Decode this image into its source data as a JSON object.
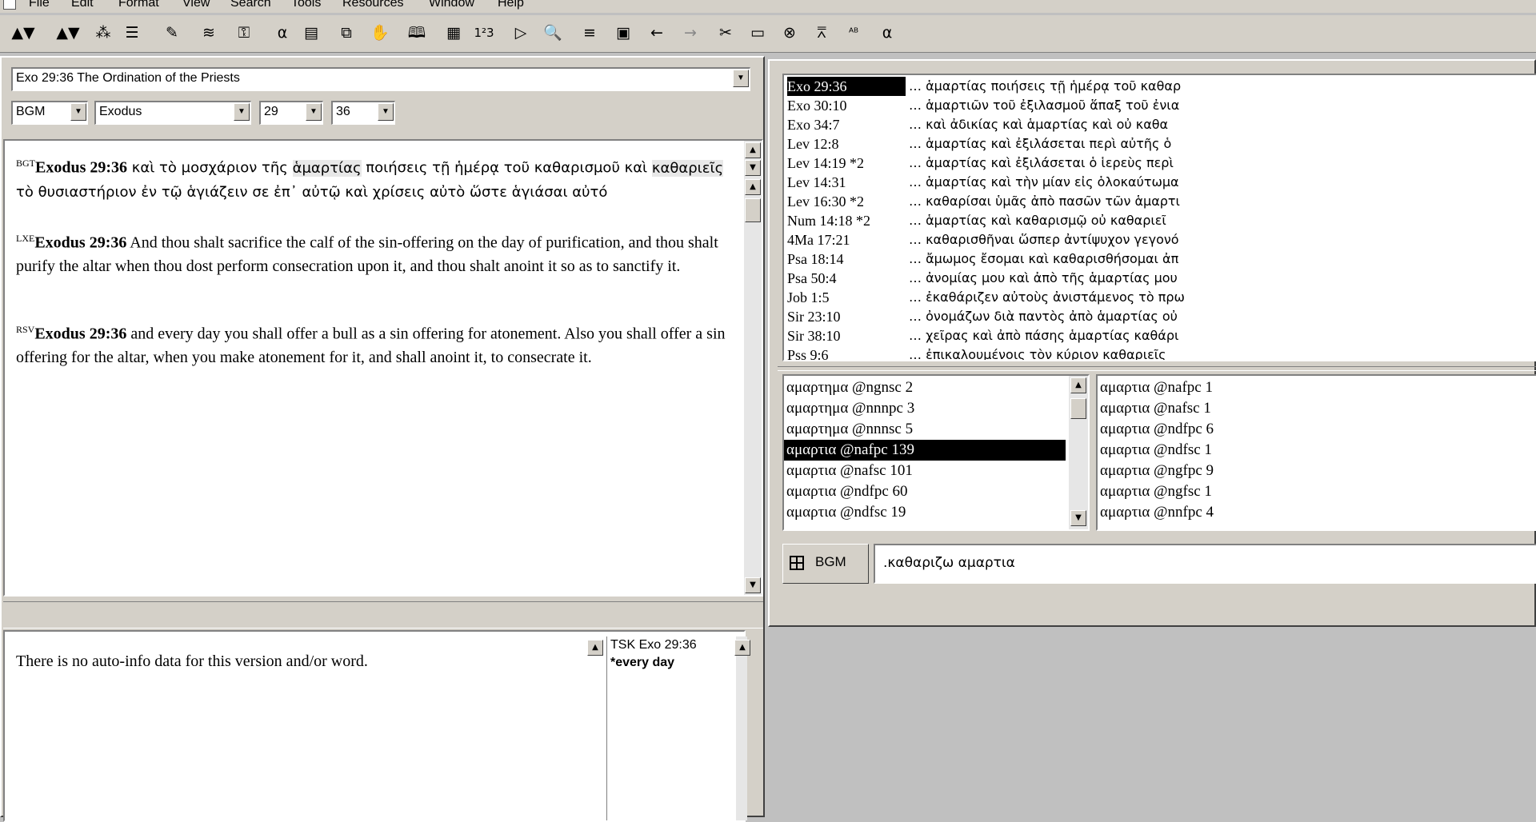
{
  "menu": [
    "File",
    "Edit",
    "Format",
    "View",
    "Search",
    "Tools",
    "Resources",
    "Window",
    "Help"
  ],
  "toolbar_icons": [
    "▲▼",
    "▲▼",
    "⁂",
    "☰",
    "✎",
    "≋",
    "⚿",
    "α",
    "▤",
    "⧉",
    "✋",
    "🕮",
    "▦",
    "1²3",
    "▷",
    "🔍",
    "≡",
    "▣",
    "←",
    "→",
    "✂",
    "▭",
    "⊗",
    "⩞",
    "ᴬᴮ",
    "α"
  ],
  "left": {
    "title": "Exo 29:36 The Ordination of the Priests",
    "version": "BGM",
    "book": "Exodus",
    "chapter": "29",
    "verse": "36",
    "verses": [
      {
        "tag": "BGT",
        "ref": "Exodus 29:36",
        "pre": " καὶ τὸ μοσχάριον τῆς ",
        "hl1": "ἁμαρτίας",
        "mid": " ποιήσεις τῇ ἡμέρᾳ τοῦ καθαρισμοῦ καὶ ",
        "hl2": "καθαριεῖς",
        "post": " τὸ θυσιαστήριον ἐν τῷ ἁγιάζειν σε ἐπ᾽ αὐτῷ καὶ χρίσεις αὐτὸ ὥστε ἁγιάσαι αὐτό"
      },
      {
        "tag": "LXE",
        "ref": "Exodus 29:36",
        "text": " And thou shalt sacrifice the calf of the sin-offering on the day of purification, and thou shalt purify the altar when thou dost perform consecration upon it, and thou shalt anoint it so as to sanctify it."
      },
      {
        "tag": "RSV",
        "ref": "Exodus 29:36",
        "text": " and every day you shall offer a bull as a sin offering for atonement. Also you shall offer a sin offering for the altar, when you make atonement for it, and shall anoint it, to consecrate it."
      }
    ],
    "autoinfo": "There is no auto-info data for this version and/or word.",
    "tsk_ref": "TSK Exo 29:36",
    "tsk_word": "*every day"
  },
  "right": {
    "results": [
      {
        "ref": "Exo 29:36",
        "text": "… ἁμαρτίας ποιήσεις τῇ ἡμέρᾳ τοῦ καθαρ",
        "selected": true
      },
      {
        "ref": "Exo 30:10",
        "text": "… ἁμαρτιῶν τοῦ ἐξιλασμοῦ ἅπαξ τοῦ ἐνια"
      },
      {
        "ref": "Exo 34:7",
        "text": "… καὶ ἀδικίας καὶ ἁμαρτίας καὶ οὐ καθα"
      },
      {
        "ref": "Lev 12:8",
        "text": "… ἁμαρτίας καὶ ἐξιλάσεται περὶ αὐτῆς ὁ"
      },
      {
        "ref": "Lev 14:19 *2",
        "text": "… ἁμαρτίας καὶ ἐξιλάσεται ὁ ἱερεὺς περὶ"
      },
      {
        "ref": "Lev 14:31",
        "text": "… ἁμαρτίας καὶ τὴν μίαν εἰς ὁλοκαύτωμα"
      },
      {
        "ref": "Lev 16:30 *2",
        "text": "… καθαρίσαι ὑμᾶς ἀπὸ πασῶν τῶν ἁμαρτι"
      },
      {
        "ref": "Num 14:18 *2",
        "text": "… ἁμαρτίας καὶ καθαρισμῷ οὐ καθαριεῖ"
      },
      {
        "ref": "4Ma 17:21",
        "text": "… καθαρισθῆναι ὥσπερ ἀντίψυχον γεγονό"
      },
      {
        "ref": "Psa 18:14",
        "text": "… ἄμωμος ἔσομαι καὶ καθαρισθήσομαι ἀπ"
      },
      {
        "ref": "Psa 50:4",
        "text": "… ἀνομίας μου καὶ ἀπὸ τῆς ἁμαρτίας μου"
      },
      {
        "ref": "Job 1:5",
        "text": "… ἐκαθάριζεν αὐτοὺς ἀνιστάμενος τὸ πρω"
      },
      {
        "ref": "Sir 23:10",
        "text": "… ὀνομάζων διὰ παντὸς ἀπὸ ἁμαρτίας οὐ"
      },
      {
        "ref": "Sir 38:10",
        "text": "… χεῖρας καὶ ἀπὸ πάσης ἁμαρτίας καθάρι"
      },
      {
        "ref": "Pss 9:6",
        "text": "… ἐπικαλουμένοις τὸν κύριον καθαριεῖς"
      }
    ],
    "forms_left": [
      {
        "label": "αμαρτημα @ngnsc 2"
      },
      {
        "label": "αμαρτημα @nnnpc 3"
      },
      {
        "label": "αμαρτημα @nnnsc 5"
      },
      {
        "label": "αμαρτια @nafpc 139",
        "selected": true
      },
      {
        "label": "αμαρτια @nafsc 101"
      },
      {
        "label": "αμαρτια @ndfpc 60"
      },
      {
        "label": "αμαρτια @ndfsc 19"
      }
    ],
    "forms_right": [
      {
        "label": "αμαρτια @nafpc 1"
      },
      {
        "label": "αμαρτια @nafsc 1"
      },
      {
        "label": "αμαρτια @ndfpc 6"
      },
      {
        "label": "αμαρτια @ndfsc 1"
      },
      {
        "label": "αμαρτια @ngfpc 9"
      },
      {
        "label": "αμαρτια @ngfsc 1"
      },
      {
        "label": "αμαρτια @nnfpc 4"
      }
    ],
    "search_version": "BGM",
    "search_query": ".καθαριζω αμαρτια"
  }
}
